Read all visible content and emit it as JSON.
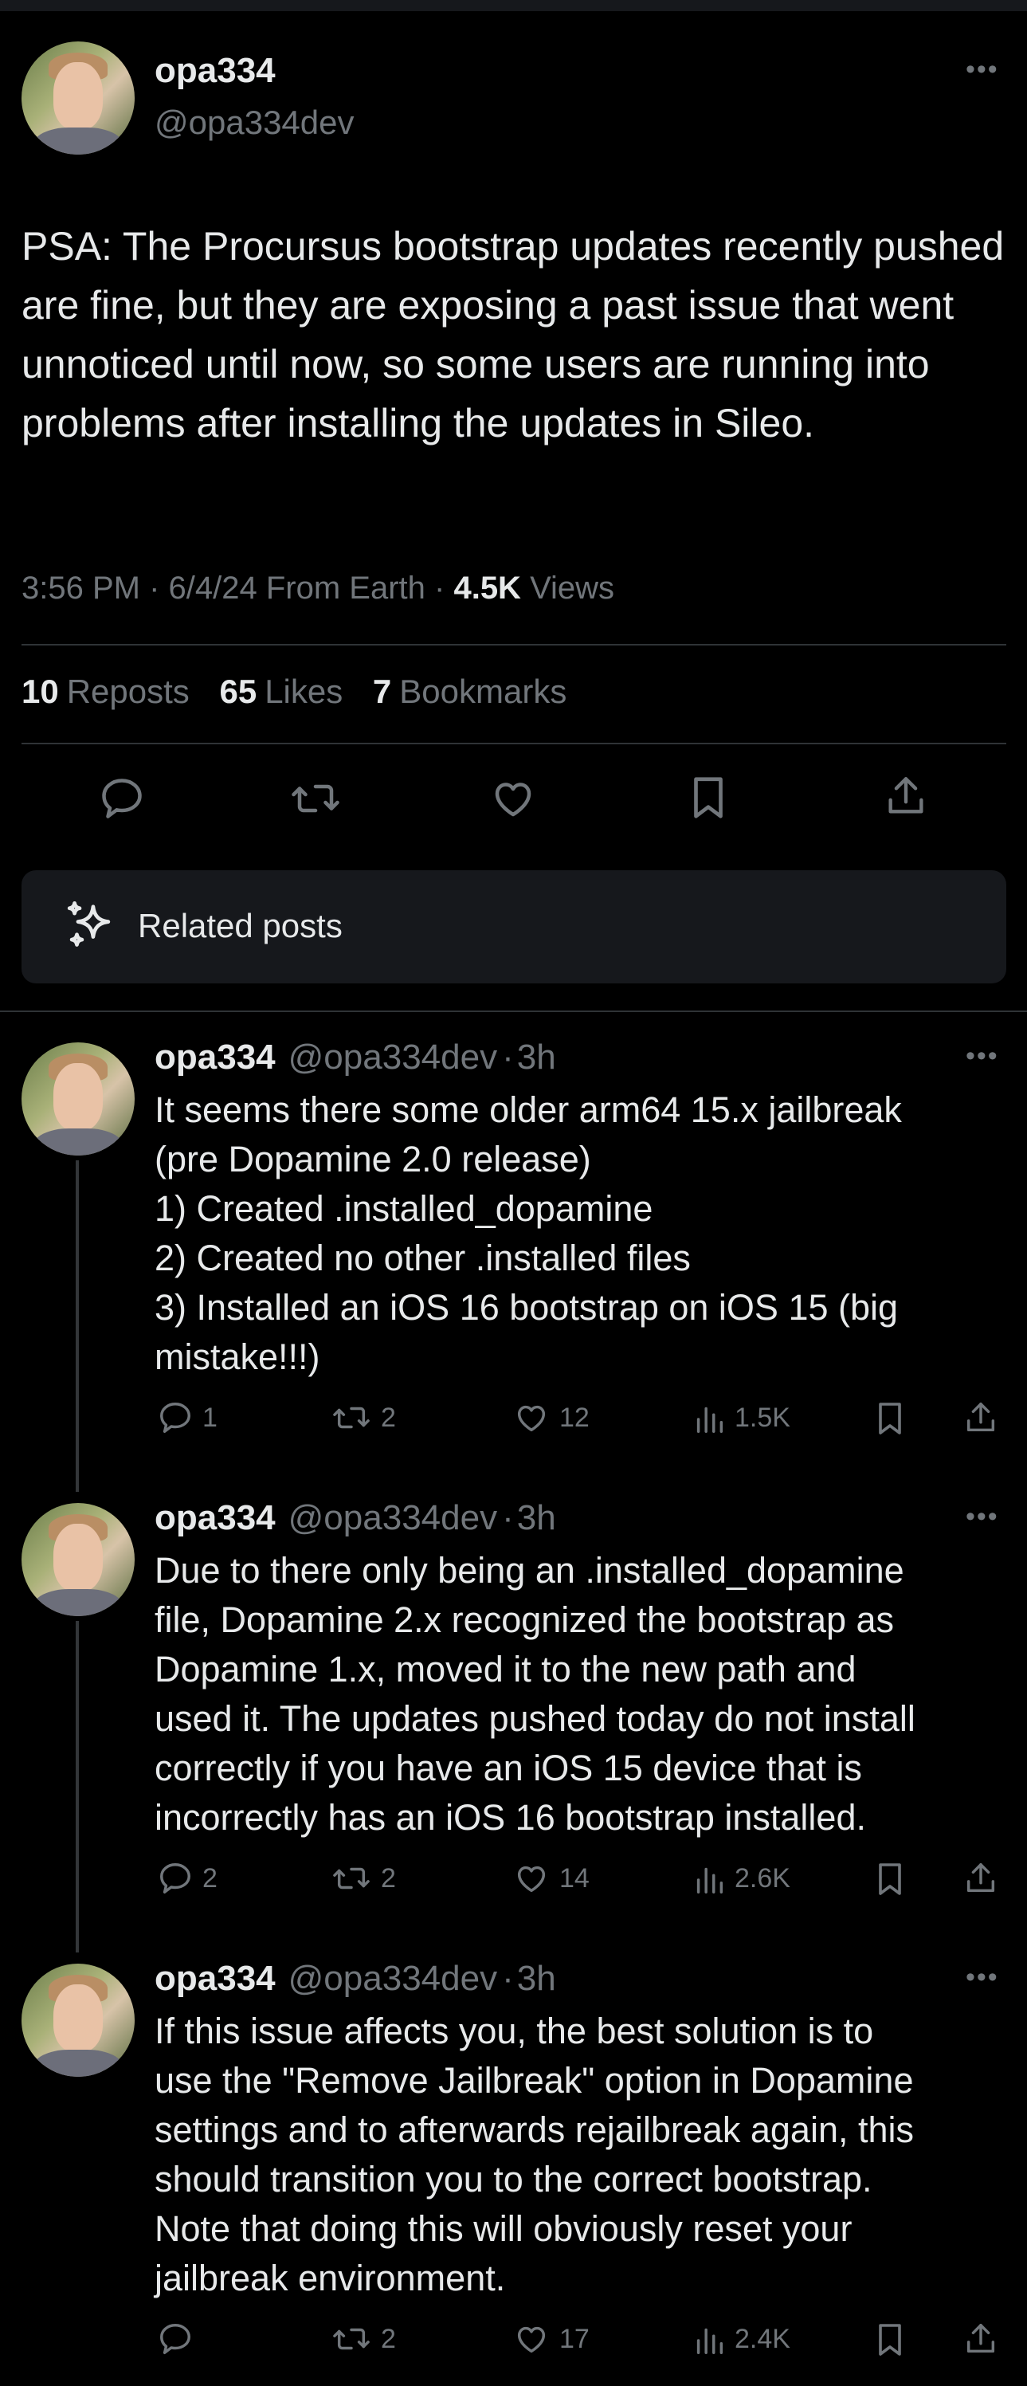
{
  "main_post": {
    "author_name": "opa334",
    "author_handle": "@opa334dev",
    "text": "PSA: The Procursus bootstrap updates recently pushed are fine, but they are exposing a past issue that went unnoticed until now, so some users are running into problems after installing the updates in Sileo.",
    "time": "3:56 PM",
    "date": "6/4/24",
    "location": "From Earth",
    "views_count": "4.5K",
    "views_label": "Views",
    "reposts_count": "10",
    "reposts_label": "Reposts",
    "likes_count": "65",
    "likes_label": "Likes",
    "bookmarks_count": "7",
    "bookmarks_label": "Bookmarks"
  },
  "related": {
    "label": "Related posts"
  },
  "replies": [
    {
      "name": "opa334",
      "handle": "@opa334dev",
      "time": "3h",
      "text": "It seems there some older arm64 15.x jailbreak\n(pre Dopamine 2.0 release)\n1) Created .installed_dopamine\n2) Created no other .installed files\n3) Installed an iOS 16 bootstrap on iOS 15 (big\nmistake!!!)",
      "replies": "1",
      "reposts": "2",
      "likes": "12",
      "views": "1.5K"
    },
    {
      "name": "opa334",
      "handle": "@opa334dev",
      "time": "3h",
      "text": "Due to there only being an .installed_dopamine\nfile, Dopamine 2.x recognized the bootstrap as\nDopamine 1.x, moved it to the new path and\nused it. The updates pushed today do not install\ncorrectly if you have an iOS 15 device that is\nincorrectly has an iOS 16 bootstrap installed.",
      "replies": "2",
      "reposts": "2",
      "likes": "14",
      "views": "2.6K"
    },
    {
      "name": "opa334",
      "handle": "@opa334dev",
      "time": "3h",
      "text": "If this issue affects you, the best solution is to\nuse the \"Remove Jailbreak\" option in Dopamine\nsettings and to afterwards rejailbreak again, this\nshould transition you to the correct bootstrap.\nNote that doing this will obviously reset your\njailbreak environment.",
      "replies": "",
      "reposts": "2",
      "likes": "17",
      "views": "2.4K"
    }
  ],
  "icons": {
    "reply": "reply-icon",
    "repost": "repost-icon",
    "like": "heart-icon",
    "bookmark": "bookmark-icon",
    "share": "share-icon",
    "views": "views-icon",
    "related": "sparkle-icon",
    "more": "more-icon"
  },
  "colors": {
    "background": "#000000",
    "text": "#e7e9ea",
    "muted": "#71767b",
    "divider": "#2f3336"
  }
}
